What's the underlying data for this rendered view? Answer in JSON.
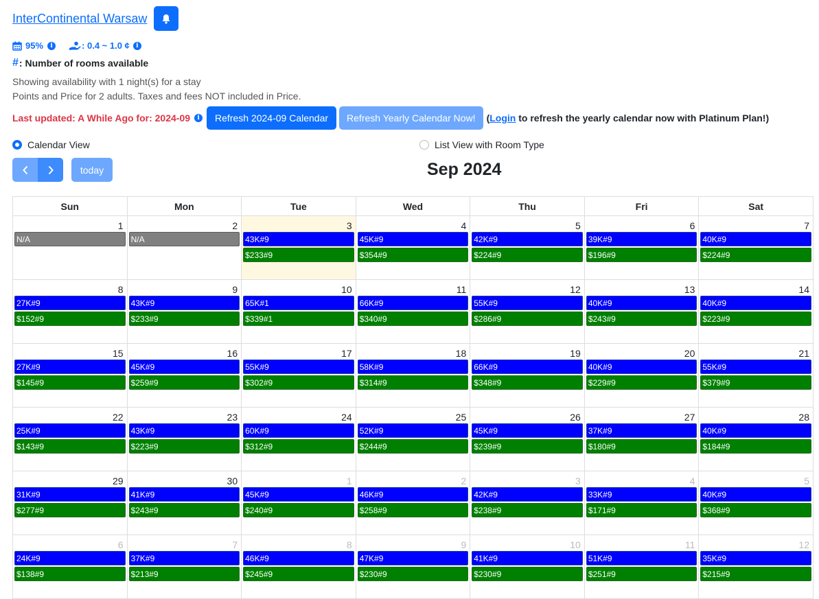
{
  "hotel": {
    "name": "InterContinental Warsaw "
  },
  "stats": {
    "occupancy": "95%",
    "value_range": ": 0.4 ~ 1.0 ¢"
  },
  "legend": {
    "symbol": "#",
    "text": ": Number of rooms available"
  },
  "notes": {
    "line1": "Showing availability with 1 night(s) for a stay",
    "line2": "Points and Price for 2 adults. Taxes and fees NOT included in Price."
  },
  "update": {
    "last_updated": "Last updated: A While Ago for: 2024-09",
    "refresh_month_label": "Refresh 2024-09 Calendar",
    "refresh_year_label": "Refresh Yearly Calendar Now!",
    "login_prefix": "(",
    "login_link": "Login",
    "login_suffix": " to refresh the yearly calendar now with Platinum Plan!)"
  },
  "views": {
    "calendar_label": "Calendar View",
    "list_label": "List View with Room Type",
    "selected": "calendar"
  },
  "toolbar": {
    "today_label": "today",
    "title": "Sep 2024"
  },
  "calendar": {
    "weekdays": [
      "Sun",
      "Mon",
      "Tue",
      "Wed",
      "Thu",
      "Fri",
      "Sat"
    ],
    "weeks": [
      [
        {
          "day": "1",
          "other": false,
          "today": false,
          "points": "N/A",
          "cash": ""
        },
        {
          "day": "2",
          "other": false,
          "today": false,
          "points": "N/A",
          "cash": ""
        },
        {
          "day": "3",
          "other": false,
          "today": true,
          "points": "43K#9",
          "cash": "$233#9"
        },
        {
          "day": "4",
          "other": false,
          "today": false,
          "points": "45K#9",
          "cash": "$354#9"
        },
        {
          "day": "5",
          "other": false,
          "today": false,
          "points": "42K#9",
          "cash": "$224#9"
        },
        {
          "day": "6",
          "other": false,
          "today": false,
          "points": "39K#9",
          "cash": "$196#9"
        },
        {
          "day": "7",
          "other": false,
          "today": false,
          "points": "40K#9",
          "cash": "$224#9"
        }
      ],
      [
        {
          "day": "8",
          "other": false,
          "today": false,
          "points": "27K#9",
          "cash": "$152#9"
        },
        {
          "day": "9",
          "other": false,
          "today": false,
          "points": "43K#9",
          "cash": "$233#9"
        },
        {
          "day": "10",
          "other": false,
          "today": false,
          "points": "65K#1",
          "cash": "$339#1"
        },
        {
          "day": "11",
          "other": false,
          "today": false,
          "points": "66K#9",
          "cash": "$340#9"
        },
        {
          "day": "12",
          "other": false,
          "today": false,
          "points": "55K#9",
          "cash": "$286#9"
        },
        {
          "day": "13",
          "other": false,
          "today": false,
          "points": "40K#9",
          "cash": "$243#9"
        },
        {
          "day": "14",
          "other": false,
          "today": false,
          "points": "40K#9",
          "cash": "$223#9"
        }
      ],
      [
        {
          "day": "15",
          "other": false,
          "today": false,
          "points": "27K#9",
          "cash": "$145#9"
        },
        {
          "day": "16",
          "other": false,
          "today": false,
          "points": "45K#9",
          "cash": "$259#9"
        },
        {
          "day": "17",
          "other": false,
          "today": false,
          "points": "55K#9",
          "cash": "$302#9"
        },
        {
          "day": "18",
          "other": false,
          "today": false,
          "points": "58K#9",
          "cash": "$314#9"
        },
        {
          "day": "19",
          "other": false,
          "today": false,
          "points": "66K#9",
          "cash": "$348#9"
        },
        {
          "day": "20",
          "other": false,
          "today": false,
          "points": "40K#9",
          "cash": "$229#9"
        },
        {
          "day": "21",
          "other": false,
          "today": false,
          "points": "55K#9",
          "cash": "$379#9"
        }
      ],
      [
        {
          "day": "22",
          "other": false,
          "today": false,
          "points": "25K#9",
          "cash": "$143#9"
        },
        {
          "day": "23",
          "other": false,
          "today": false,
          "points": "43K#9",
          "cash": "$223#9"
        },
        {
          "day": "24",
          "other": false,
          "today": false,
          "points": "60K#9",
          "cash": "$312#9"
        },
        {
          "day": "25",
          "other": false,
          "today": false,
          "points": "52K#9",
          "cash": "$244#9"
        },
        {
          "day": "26",
          "other": false,
          "today": false,
          "points": "45K#9",
          "cash": "$239#9"
        },
        {
          "day": "27",
          "other": false,
          "today": false,
          "points": "37K#9",
          "cash": "$180#9"
        },
        {
          "day": "28",
          "other": false,
          "today": false,
          "points": "40K#9",
          "cash": "$184#9"
        }
      ],
      [
        {
          "day": "29",
          "other": false,
          "today": false,
          "points": "31K#9",
          "cash": "$277#9"
        },
        {
          "day": "30",
          "other": false,
          "today": false,
          "points": "41K#9",
          "cash": "$243#9"
        },
        {
          "day": "1",
          "other": true,
          "today": false,
          "points": "45K#9",
          "cash": "$240#9"
        },
        {
          "day": "2",
          "other": true,
          "today": false,
          "points": "46K#9",
          "cash": "$258#9"
        },
        {
          "day": "3",
          "other": true,
          "today": false,
          "points": "42K#9",
          "cash": "$238#9"
        },
        {
          "day": "4",
          "other": true,
          "today": false,
          "points": "33K#9",
          "cash": "$171#9"
        },
        {
          "day": "5",
          "other": true,
          "today": false,
          "points": "40K#9",
          "cash": "$368#9"
        }
      ],
      [
        {
          "day": "6",
          "other": true,
          "today": false,
          "points": "24K#9",
          "cash": "$138#9"
        },
        {
          "day": "7",
          "other": true,
          "today": false,
          "points": "37K#9",
          "cash": "$213#9"
        },
        {
          "day": "8",
          "other": true,
          "today": false,
          "points": "46K#9",
          "cash": "$245#9"
        },
        {
          "day": "9",
          "other": true,
          "today": false,
          "points": "47K#9",
          "cash": "$230#9"
        },
        {
          "day": "10",
          "other": true,
          "today": false,
          "points": "41K#9",
          "cash": "$230#9"
        },
        {
          "day": "11",
          "other": true,
          "today": false,
          "points": "51K#9",
          "cash": "$251#9"
        },
        {
          "day": "12",
          "other": true,
          "today": false,
          "points": "35K#9",
          "cash": "$215#9"
        }
      ]
    ]
  },
  "colors": {
    "accent": "#0d6efd",
    "points_event": "#0000ff",
    "cash_event": "#008000",
    "na_event": "#808080",
    "today_bg": "#fff8e1",
    "alert": "#dc3545"
  }
}
